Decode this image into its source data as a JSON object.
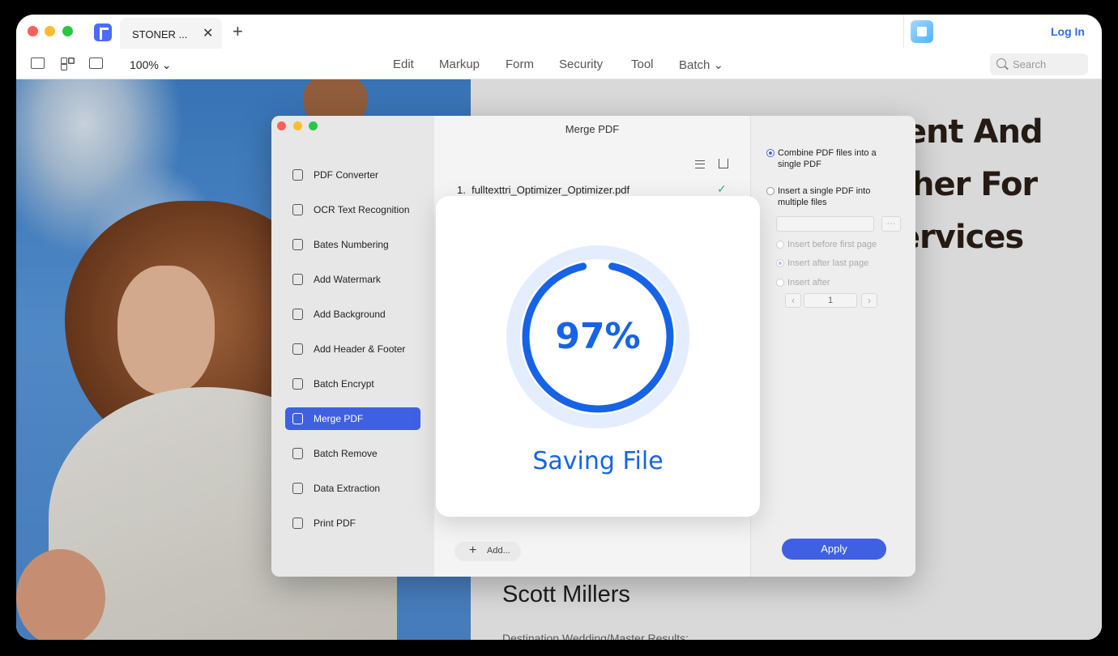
{
  "tab": {
    "title": "STONER ...",
    "close": "✕",
    "new": "+"
  },
  "header": {
    "login": "Log In"
  },
  "toolbar": {
    "zoom": "100%",
    "menus": [
      "Edit",
      "Markup",
      "Form",
      "Security",
      "Tool",
      "Batch"
    ],
    "search_placeholder": "Search"
  },
  "document": {
    "headline": [
      "elligent And",
      "grapher For",
      "ty Services"
    ],
    "name": "Scott Millers",
    "subtitle": "Destination Wedding/Master Results:"
  },
  "merge_window": {
    "title": "Merge PDF",
    "sidebar": [
      {
        "label": "PDF Converter",
        "icon": "refresh-icon"
      },
      {
        "label": "OCR Text Recognition",
        "icon": "scan-icon"
      },
      {
        "label": "Bates Numbering",
        "icon": "bates-icon"
      },
      {
        "label": "Add Watermark",
        "icon": "watermark-icon"
      },
      {
        "label": "Add Background",
        "icon": "background-icon"
      },
      {
        "label": "Add Header & Footer",
        "icon": "header-footer-icon"
      },
      {
        "label": "Batch Encrypt",
        "icon": "lock-icon"
      },
      {
        "label": "Merge PDF",
        "icon": "merge-icon",
        "active": true
      },
      {
        "label": "Batch Remove",
        "icon": "trash-icon"
      },
      {
        "label": "Data Extraction",
        "icon": "export-icon"
      },
      {
        "label": "Print PDF",
        "icon": "printer-icon"
      }
    ],
    "files": [
      {
        "number": "1.",
        "name": "fulltexttri_Optimizer_Optimizer.pdf",
        "status": "✓"
      }
    ],
    "add_label": "Add...",
    "options": {
      "combine": "Combine PDF files into a single PDF",
      "insert": "Insert a single PDF into multiple files",
      "before_first": "Insert before first page",
      "after_last": "Insert after last page",
      "insert_after": "Insert after",
      "page_value": "1",
      "selected": "combine"
    },
    "apply_label": "Apply"
  },
  "progress": {
    "percent": 97,
    "percent_label": "97%",
    "status": "Saving File"
  },
  "colors": {
    "accent": "#4060e3",
    "progress": "#1663e8",
    "track": "#e3edfd",
    "login": "#2f6cf5"
  }
}
